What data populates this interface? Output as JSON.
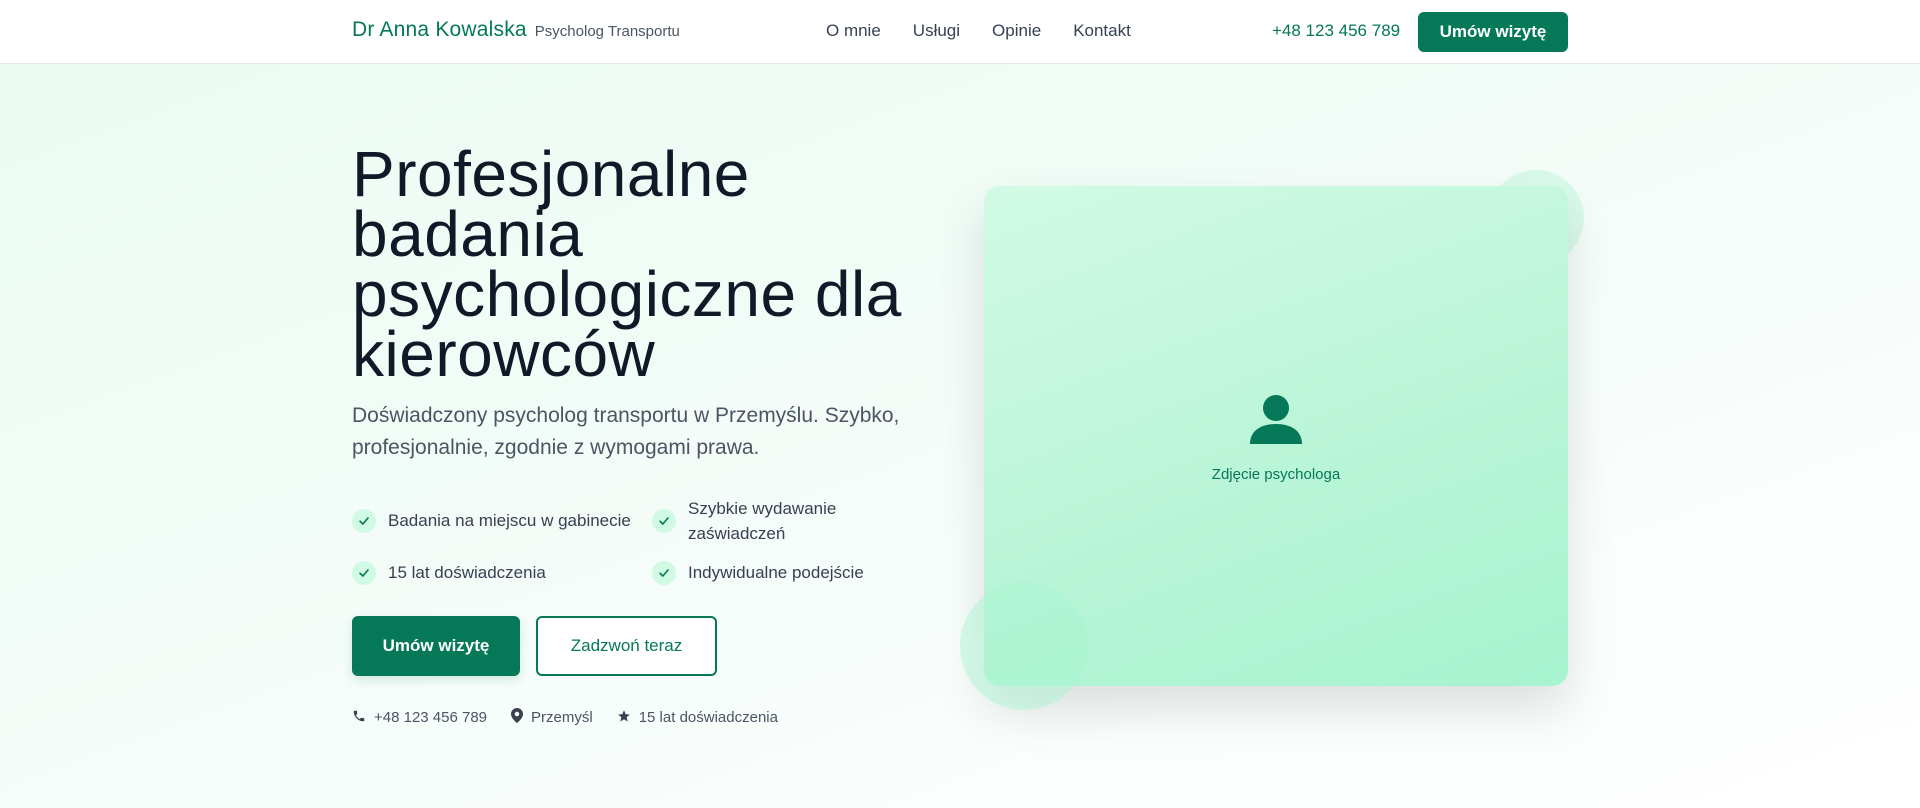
{
  "header": {
    "brand_name": "Dr Anna Kowalska",
    "brand_sub": "Psycholog Transportu",
    "nav": [
      {
        "label": "O mnie"
      },
      {
        "label": "Usługi"
      },
      {
        "label": "Opinie"
      },
      {
        "label": "Kontakt"
      }
    ],
    "phone": "+48 123 456 789",
    "cta_label": "Umów wizytę"
  },
  "hero": {
    "title": "Profesjonalne badania psychologiczne dla kierowców",
    "subtitle": "Doświadczony psycholog transportu w Przemyślu. Szybko, profesjonalnie, zgodnie z wymogami prawa.",
    "features": [
      {
        "label": "Badania na miejscu w gabinecie"
      },
      {
        "label": "Szybkie wydawanie zaświadczeń"
      },
      {
        "label": "15 lat doświadczenia"
      },
      {
        "label": "Indywidualne podejście"
      }
    ],
    "primary_button": "Umów wizytę",
    "secondary_button": "Zadzwoń teraz",
    "meta": {
      "phone": "+48 123 456 789",
      "location": "Przemyśl",
      "experience": "15 lat doświadczenia"
    },
    "photo_label": "Zdjęcie psychologa"
  },
  "icons": {
    "check": "check-icon",
    "phone": "phone-icon",
    "location": "map-pin-icon",
    "star": "star-icon",
    "person": "person-icon"
  },
  "colors": {
    "accent": "#047857",
    "accent_light": "#d1fae5",
    "card": "#a7f3d0",
    "text_dark": "#111827",
    "text_muted": "#4b5563"
  }
}
